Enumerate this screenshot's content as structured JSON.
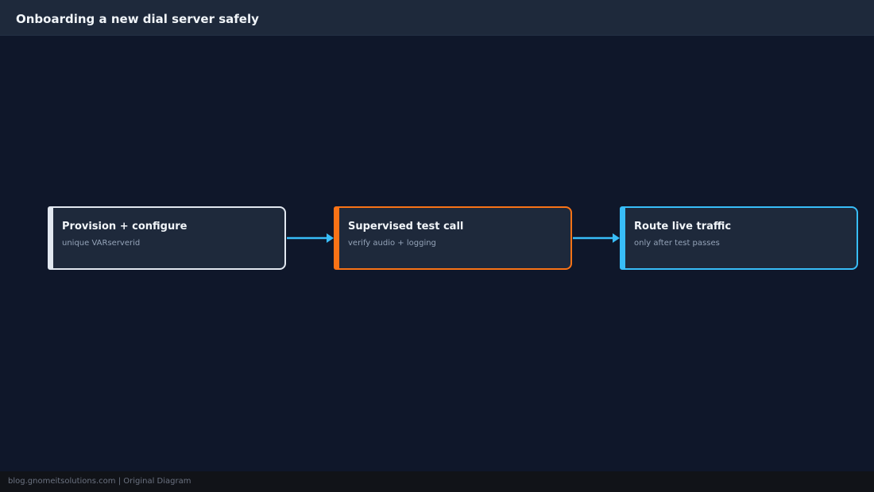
{
  "header": {
    "title": "Onboarding a new dial server safely"
  },
  "diagram": {
    "nodes": [
      {
        "id": "provision",
        "title": "Provision + configure",
        "subtitle": "unique VARserverid",
        "color": "#e2e8f0"
      },
      {
        "id": "test-call",
        "title": "Supervised test call",
        "subtitle": "verify audio + logging",
        "color": "#f97316"
      },
      {
        "id": "route",
        "title": "Route live traffic",
        "subtitle": "only after test passes",
        "color": "#38bdf8"
      }
    ],
    "edges": [
      {
        "from": "provision",
        "to": "test-call"
      },
      {
        "from": "test-call",
        "to": "route"
      }
    ],
    "edge_color": "#38bdf8"
  },
  "footer": {
    "text": "blog.gnomeitsolutions.com | Original Diagram"
  },
  "colors": {
    "background": "#0f172a",
    "header": "#1e293b",
    "node_fill": "#1e293b",
    "footer": "#111318"
  }
}
